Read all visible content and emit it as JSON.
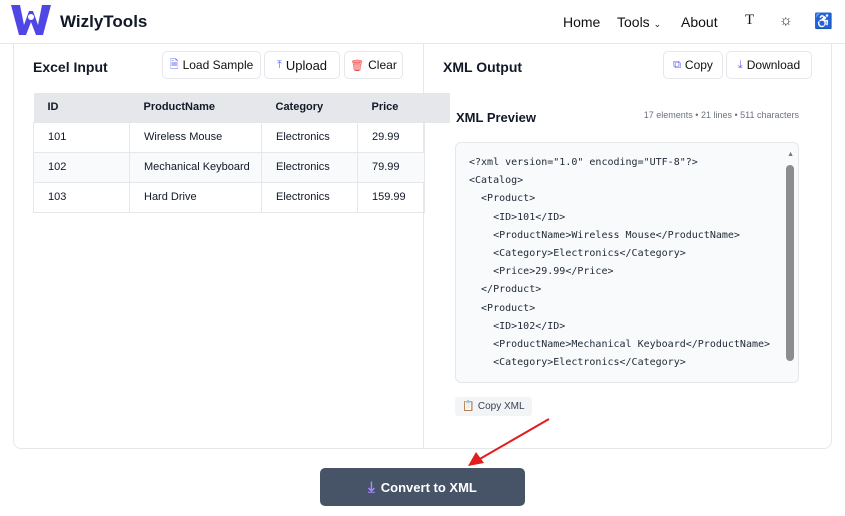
{
  "header": {
    "brand": "WizlyTools",
    "nav": [
      {
        "label": "Home"
      },
      {
        "label": "Tools"
      },
      {
        "label": "About"
      }
    ],
    "icons": [
      "text-size-icon",
      "sun-icon",
      "accessibility-icon"
    ]
  },
  "input": {
    "title": "Excel Input",
    "buttons": {
      "load_sample": "Load Sample",
      "upload": "Upload",
      "clear": "Clear"
    },
    "table": {
      "headers": [
        "ID",
        "ProductName",
        "Category",
        "Price"
      ],
      "rows": [
        [
          "101",
          "Wireless Mouse",
          "Electronics",
          "29.99"
        ],
        [
          "102",
          "Mechanical Keyboard",
          "Electronics",
          "79.99"
        ],
        [
          "103",
          "Hard Drive",
          "Electronics",
          "159.99"
        ]
      ]
    }
  },
  "output": {
    "title": "XML Output",
    "buttons": {
      "copy": "Copy",
      "download": "Download"
    },
    "preview_title": "XML Preview",
    "meta": "17 elements • 21 lines • 511 characters",
    "xml": "<?xml version=\"1.0\" encoding=\"UTF-8\"?>\n<Catalog>\n  <Product>\n    <ID>101</ID>\n    <ProductName>Wireless Mouse</ProductName>\n    <Category>Electronics</Category>\n    <Price>29.99</Price>\n  </Product>\n  <Product>\n    <ID>102</ID>\n    <ProductName>Mechanical Keyboard</ProductName>\n    <Category>Electronics</Category>",
    "copy_xml": "Copy XML"
  },
  "convert": {
    "label": "Convert to XML"
  },
  "colors": {
    "brand": "#4f46e5",
    "convert_bg": "#475467",
    "annotation_arrow": "#e11d1d"
  }
}
